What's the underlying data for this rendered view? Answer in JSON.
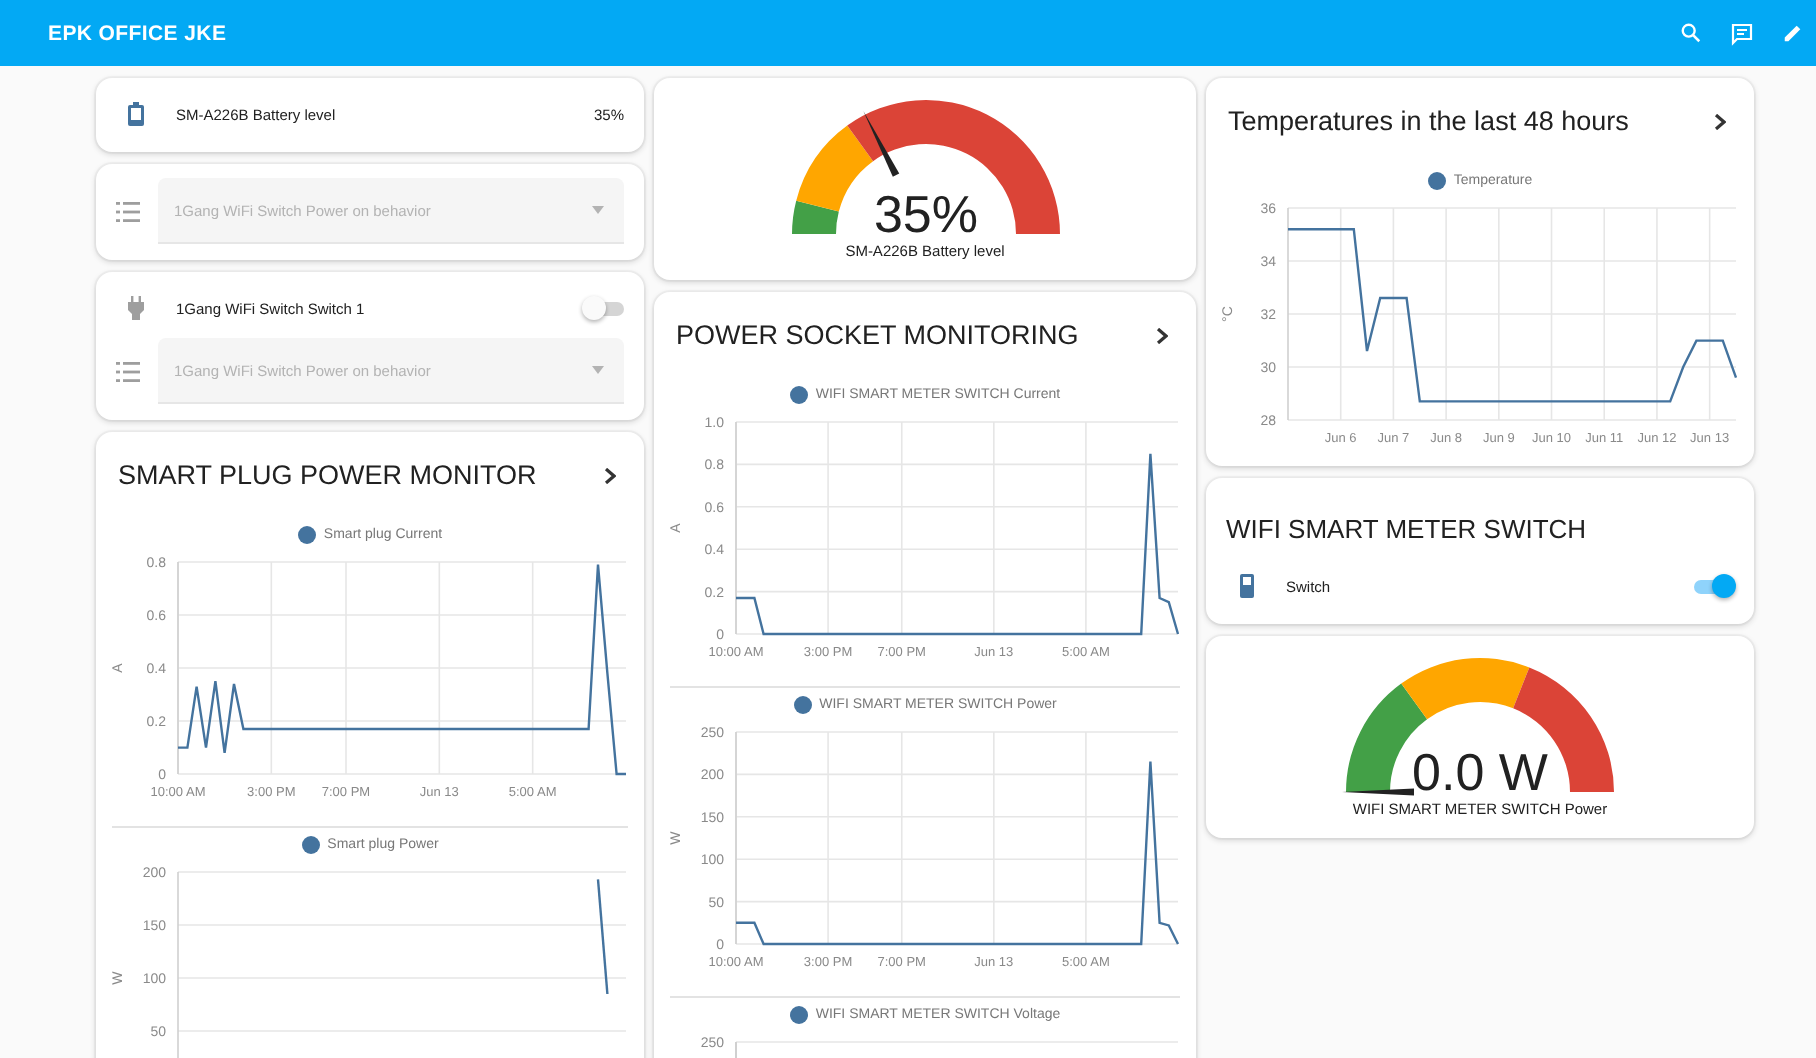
{
  "header": {
    "title": "EPK OFFICE JKE"
  },
  "columns": [
    {
      "cards": [
        {
          "kind": "entities",
          "rows": [
            {
              "kind": "sensor",
              "name": "SM-A226B Battery level",
              "value": "35%"
            }
          ]
        },
        {
          "kind": "entities",
          "rows": [
            {
              "kind": "select",
              "label": "1Gang WiFi Switch Power on behavior",
              "disabled": true
            }
          ]
        },
        {
          "kind": "entities",
          "rows": [
            {
              "kind": "outlet",
              "name": "1Gang WiFi Switch Switch 1",
              "on": false
            },
            {
              "kind": "select",
              "label": "1Gang WiFi Switch Power on behavior",
              "disabled": true
            }
          ]
        },
        {
          "kind": "history",
          "title": "SMART PLUG POWER MONITOR",
          "charts": [
            {
              "chart_data": {
                "type": "line",
                "ylabel": "A",
                "categories": [
                  "10:00 AM",
                  null,
                  null,
                  null,
                  null,
                  null,
                  null,
                  null,
                  null,
                  null,
                  "3:00 PM",
                  null,
                  null,
                  null,
                  null,
                  null,
                  null,
                  null,
                  "7:00 PM",
                  null,
                  null,
                  null,
                  null,
                  null,
                  null,
                  null,
                  null,
                  null,
                  "Jun 13",
                  null,
                  null,
                  null,
                  null,
                  null,
                  null,
                  null,
                  null,
                  null,
                  "5:00 AM",
                  null,
                  null,
                  null,
                  null,
                  null,
                  null,
                  null,
                  null,
                  null,
                  null
                ],
                "series": [
                  {
                    "name": "Smart plug Current",
                    "color": "#44739e",
                    "values": [
                      0.1,
                      0.1,
                      0.33,
                      0.1,
                      0.35,
                      0.08,
                      0.34,
                      0.17,
                      0.17,
                      0.17,
                      0.17,
                      0.17,
                      0.17,
                      0.17,
                      0.17,
                      0.17,
                      0.17,
                      0.17,
                      0.17,
                      0.17,
                      0.17,
                      0.17,
                      0.17,
                      0.17,
                      0.17,
                      0.17,
                      0.17,
                      0.17,
                      0.17,
                      0.17,
                      0.17,
                      0.17,
                      0.17,
                      0.17,
                      0.17,
                      0.17,
                      0.17,
                      0.17,
                      0.17,
                      0.17,
                      0.17,
                      0.17,
                      0.17,
                      0.17,
                      0.17,
                      0.79,
                      0.38,
                      0,
                      0
                    ]
                  }
                ],
                "grid": true,
                "ylim": [
                  0,
                  0.8
                ],
                "yticks": [
                  0,
                  0.2,
                  0.4,
                  0.6,
                  0.8
                ]
              }
            },
            {
              "chart_data": {
                "type": "line",
                "ylabel": "W",
                "categories": [
                  null,
                  null,
                  null,
                  null,
                  null,
                  null,
                  null,
                  null,
                  null,
                  null,
                  null,
                  null,
                  null,
                  null,
                  null,
                  null,
                  null,
                  null,
                  null,
                  null,
                  null,
                  null,
                  null,
                  null,
                  null,
                  null,
                  null,
                  null,
                  null,
                  null,
                  null,
                  null,
                  null,
                  null,
                  null,
                  null,
                  null,
                  null,
                  null,
                  null,
                  null,
                  null,
                  null,
                  null,
                  null,
                  null,
                  null,
                  null,
                  null
                ],
                "series": [
                  {
                    "name": "Smart plug Power",
                    "color": "#44739e",
                    "values": [
                      null,
                      null,
                      null,
                      null,
                      null,
                      null,
                      null,
                      null,
                      null,
                      null,
                      null,
                      null,
                      null,
                      null,
                      null,
                      null,
                      null,
                      null,
                      null,
                      null,
                      null,
                      null,
                      null,
                      null,
                      null,
                      null,
                      null,
                      null,
                      null,
                      null,
                      null,
                      null,
                      null,
                      null,
                      null,
                      null,
                      null,
                      null,
                      null,
                      null,
                      null,
                      null,
                      null,
                      null,
                      null,
                      193,
                      85,
                      null,
                      null
                    ]
                  }
                ],
                "grid": true,
                "ylim": [
                  0,
                  200
                ],
                "yticks": [
                  50,
                  100,
                  150,
                  200
                ]
              }
            }
          ]
        }
      ]
    },
    {
      "cards": [
        {
          "kind": "gauge",
          "value": "35%",
          "name": "SM-A226B Battery level",
          "segments": [
            {
              "color": "#43a047"
            },
            {
              "color": "#ffa600"
            },
            {
              "color": "#db4437"
            }
          ]
        },
        {
          "kind": "history",
          "title": "POWER SOCKET MONITORING",
          "charts": [
            {
              "chart_data": {
                "type": "line",
                "ylabel": "A",
                "categories": [
                  "10:00 AM",
                  null,
                  null,
                  null,
                  null,
                  null,
                  null,
                  null,
                  null,
                  null,
                  "3:00 PM",
                  null,
                  null,
                  null,
                  null,
                  null,
                  null,
                  null,
                  "7:00 PM",
                  null,
                  null,
                  null,
                  null,
                  null,
                  null,
                  null,
                  null,
                  null,
                  "Jun 13",
                  null,
                  null,
                  null,
                  null,
                  null,
                  null,
                  null,
                  null,
                  null,
                  "5:00 AM",
                  null,
                  null,
                  null,
                  null,
                  null,
                  null,
                  null,
                  null,
                  null,
                  null
                ],
                "series": [
                  {
                    "name": "WIFI SMART METER SWITCH Current",
                    "color": "#44739e",
                    "values": [
                      0.17,
                      0.17,
                      0.17,
                      0,
                      0,
                      0,
                      0,
                      0,
                      0,
                      0,
                      0,
                      0,
                      0,
                      0,
                      0,
                      0,
                      0,
                      0,
                      0,
                      0,
                      0,
                      0,
                      0,
                      0,
                      0,
                      0,
                      0,
                      0,
                      0,
                      0,
                      0,
                      0,
                      0,
                      0,
                      0,
                      0,
                      0,
                      0,
                      0,
                      0,
                      0,
                      0,
                      0,
                      0,
                      0,
                      0.85,
                      0.17,
                      0.15,
                      0
                    ]
                  }
                ],
                "grid": true,
                "ylim": [
                  0,
                  1
                ],
                "yticks": [
                  0,
                  0.2,
                  0.4,
                  0.6,
                  0.8,
                  {
                    "value": 1,
                    "label": "1.0"
                  }
                ]
              }
            },
            {
              "chart_data": {
                "type": "line",
                "ylabel": "W",
                "categories": [
                  "10:00 AM",
                  null,
                  null,
                  null,
                  null,
                  null,
                  null,
                  null,
                  null,
                  null,
                  "3:00 PM",
                  null,
                  null,
                  null,
                  null,
                  null,
                  null,
                  null,
                  "7:00 PM",
                  null,
                  null,
                  null,
                  null,
                  null,
                  null,
                  null,
                  null,
                  null,
                  "Jun 13",
                  null,
                  null,
                  null,
                  null,
                  null,
                  null,
                  null,
                  null,
                  null,
                  "5:00 AM",
                  null,
                  null,
                  null,
                  null,
                  null,
                  null,
                  null,
                  null,
                  null,
                  null
                ],
                "series": [
                  {
                    "name": "WIFI SMART METER SWITCH Power",
                    "color": "#44739e",
                    "values": [
                      25,
                      25,
                      25,
                      0,
                      0,
                      0,
                      0,
                      0,
                      0,
                      0,
                      0,
                      0,
                      0,
                      0,
                      0,
                      0,
                      0,
                      0,
                      0,
                      0,
                      0,
                      0,
                      0,
                      0,
                      0,
                      0,
                      0,
                      0,
                      0,
                      0,
                      0,
                      0,
                      0,
                      0,
                      0,
                      0,
                      0,
                      0,
                      0,
                      0,
                      0,
                      0,
                      0,
                      0,
                      0,
                      215,
                      25,
                      22,
                      0
                    ]
                  }
                ],
                "grid": true,
                "ylim": [
                  0,
                  250
                ],
                "yticks": [
                  0,
                  50,
                  100,
                  150,
                  200,
                  250
                ]
              }
            },
            {
              "legend": {
                "name": "WIFI SMART METER SWITCH Voltage",
                "color": "#44739e"
              },
              "top_tick": "250"
            }
          ]
        }
      ]
    },
    {
      "cards": [
        {
          "kind": "history",
          "title": "Temperatures in the last 48 hours",
          "charts": [
            {
              "chart_data": {
                "type": "line",
                "ylabel": "°C",
                "categories": [
                  null,
                  null,
                  null,
                  null,
                  "Jun 6",
                  null,
                  null,
                  null,
                  "Jun 7",
                  null,
                  null,
                  null,
                  "Jun 8",
                  null,
                  null,
                  null,
                  "Jun 9",
                  null,
                  null,
                  null,
                  "Jun 10",
                  null,
                  null,
                  null,
                  "Jun 11",
                  null,
                  null,
                  null,
                  "Jun 12",
                  null,
                  null,
                  null,
                  "Jun 13",
                  null,
                  null
                ],
                "series": [
                  {
                    "name": "Temperature",
                    "color": "#44739e",
                    "values": [
                      35.2,
                      35.2,
                      35.2,
                      35.2,
                      35.2,
                      35.2,
                      30.6,
                      32.6,
                      32.6,
                      32.6,
                      28.7,
                      28.7,
                      28.7,
                      28.7,
                      28.7,
                      28.7,
                      28.7,
                      28.7,
                      28.7,
                      28.7,
                      28.7,
                      28.7,
                      28.7,
                      28.7,
                      28.7,
                      28.7,
                      28.7,
                      28.7,
                      28.7,
                      28.7,
                      30,
                      31,
                      31,
                      31,
                      29.6
                    ]
                  }
                ],
                "grid": true,
                "ylim": [
                  28,
                  36
                ],
                "yticks": [
                  28,
                  30,
                  32,
                  34,
                  36
                ]
              }
            }
          ]
        },
        {
          "kind": "entities",
          "title": "WIFI SMART METER SWITCH",
          "rows": [
            {
              "kind": "switch",
              "name": "Switch",
              "on": true
            }
          ]
        },
        {
          "kind": "gauge",
          "value": "0.0 W",
          "name": "WIFI SMART METER SWITCH Power",
          "segments": [
            {
              "color": "#43a047"
            },
            {
              "color": "#ffa600"
            },
            {
              "color": "#db4437"
            }
          ]
        }
      ]
    }
  ]
}
